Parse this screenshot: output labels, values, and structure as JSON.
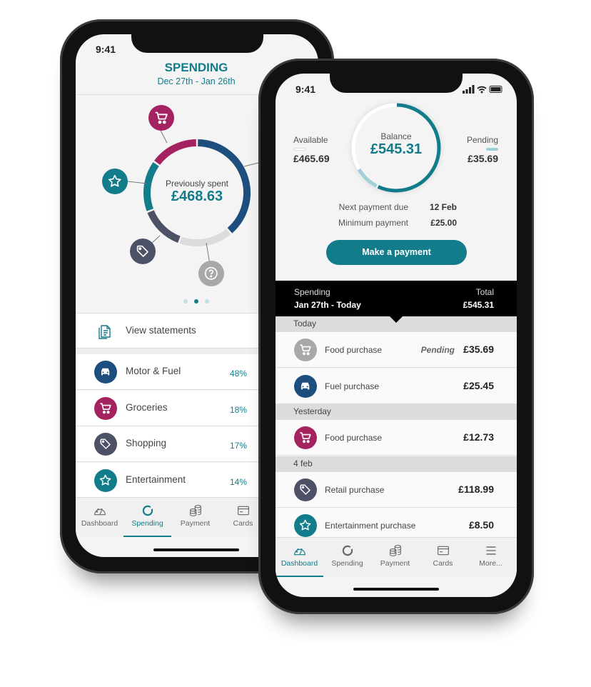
{
  "colors": {
    "teal": "#137c8b",
    "navy": "#1d4e7e",
    "magenta": "#a3225f",
    "slate": "#4d5166",
    "grey": "#a8a8a8",
    "light_teal": "#9fd0d8"
  },
  "spending_screen": {
    "status_time": "9:41",
    "title": "SPENDING",
    "period": "Dec 27th - Jan 26th",
    "donut": {
      "label": "Previously spent",
      "amount": "£468.63",
      "category_icons": [
        "cart-icon",
        "star-icon",
        "tag-icon",
        "question-icon"
      ]
    },
    "page_dots": {
      "count": 3,
      "active": 1
    },
    "view_statements": "View statements",
    "categories": [
      {
        "label": "Motor & Fuel",
        "percent": "48%",
        "icon": "car-icon",
        "color": "#1d4e7e"
      },
      {
        "label": "Groceries",
        "percent": "18%",
        "icon": "cart-icon",
        "color": "#a3225f"
      },
      {
        "label": "Shopping",
        "percent": "17%",
        "icon": "tag-icon",
        "color": "#4d5166"
      },
      {
        "label": "Entertainment",
        "percent": "14%",
        "icon": "star-icon",
        "color": "#137c8b"
      }
    ],
    "tabs": [
      {
        "label": "Dashboard",
        "icon": "gauge-icon"
      },
      {
        "label": "Spending",
        "icon": "donut-icon",
        "active": true
      },
      {
        "label": "Payment",
        "icon": "coins-icon"
      },
      {
        "label": "Cards",
        "icon": "card-icon"
      }
    ]
  },
  "dashboard_screen": {
    "status_time": "9:41",
    "balance": {
      "label": "Balance",
      "amount": "£545.31"
    },
    "available": {
      "label": "Available",
      "amount": "£465.69"
    },
    "pending": {
      "label": "Pending",
      "amount": "£35.69"
    },
    "next_payment": {
      "label": "Next payment due",
      "value": "12 Feb"
    },
    "minimum_payment": {
      "label": "Minimum payment",
      "value": "£25.00"
    },
    "make_payment": "Make a payment",
    "spending_header": {
      "label": "Spending",
      "period": "Jan 27th - Today",
      "total_label": "Total",
      "total": "£545.31"
    },
    "sections": [
      {
        "title": "Today",
        "items": [
          {
            "label": "Food purchase",
            "status": "Pending",
            "amount": "£35.69",
            "icon": "cart-icon",
            "color": "#a8a8a8"
          },
          {
            "label": "Fuel purchase",
            "amount": "£25.45",
            "icon": "car-icon",
            "color": "#1d4e7e"
          }
        ]
      },
      {
        "title": "Yesterday",
        "items": [
          {
            "label": "Food purchase",
            "amount": "£12.73",
            "icon": "cart-icon",
            "color": "#a3225f"
          }
        ]
      },
      {
        "title": "4 feb",
        "items": [
          {
            "label": "Retail purchase",
            "amount": "£118.99",
            "icon": "tag-icon",
            "color": "#4d5166"
          },
          {
            "label": "Entertainment purchase",
            "amount": "£8.50",
            "icon": "star-icon",
            "color": "#137c8b"
          }
        ]
      }
    ],
    "tabs": [
      {
        "label": "Dashboard",
        "icon": "gauge-icon",
        "active": true
      },
      {
        "label": "Spending",
        "icon": "donut-icon"
      },
      {
        "label": "Payment",
        "icon": "coins-icon"
      },
      {
        "label": "Cards",
        "icon": "card-icon"
      },
      {
        "label": "More...",
        "icon": "menu-icon"
      }
    ]
  }
}
